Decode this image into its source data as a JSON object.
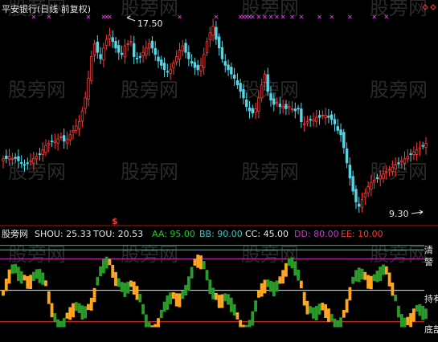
{
  "title": "平安银行(日线 前复权)",
  "panel1": {
    "annotation_high": "17.50",
    "annotation_low": "9.30",
    "dividend_marker": "$"
  },
  "panel2": {
    "name": "股旁网",
    "items": [
      {
        "label": "SHOU: 25.33",
        "color": "#e6e6e6"
      },
      {
        "label": "TOU: 20.53",
        "color": "#e6e6e6"
      },
      {
        "label": "AA: 95.00",
        "color": "#22cc22"
      },
      {
        "label": "BB: 90.00",
        "color": "#33cccc"
      },
      {
        "label": "CC: 45.00",
        "color": "#e6e6e6"
      },
      {
        "label": "DD: 80.00",
        "color": "#cc33cc"
      },
      {
        "label": "EE: 10.00",
        "color": "#ff3333"
      }
    ],
    "right_labels": [
      "清",
      "警",
      "持有",
      "底部"
    ],
    "levels": {
      "AA": 95,
      "BB": 90,
      "DD": 80,
      "CC": 45,
      "EE": 10
    }
  },
  "watermark": "股旁网",
  "colors": {
    "up": "#ff3b3b",
    "down": "#54d8e8",
    "osc_above": "#ffa621",
    "osc_below": "#2a9a2a",
    "separator": "#b01515",
    "marker_x": "#cc33cc",
    "marker_diamond": "#ff3333"
  },
  "chart_data": {
    "type": "candlestick",
    "x": [
      0,
      1,
      2,
      3,
      4,
      5,
      6,
      7,
      8,
      9,
      10,
      11,
      12,
      13,
      14,
      15,
      16,
      17,
      18,
      19,
      20,
      21,
      22,
      23,
      24,
      25,
      26,
      27,
      28,
      29,
      30,
      31,
      32,
      33,
      34,
      35,
      36,
      37,
      38,
      39,
      40,
      41,
      42,
      43,
      44,
      45,
      46,
      47,
      48,
      49,
      50,
      51,
      52,
      53,
      54,
      55,
      56,
      57,
      58,
      59,
      60,
      61,
      62,
      63,
      64,
      65,
      66,
      67,
      68,
      69,
      70,
      71,
      72,
      73,
      74,
      75,
      76,
      77,
      78,
      79,
      80,
      81,
      82,
      83,
      84,
      85,
      86,
      87,
      88,
      89,
      90,
      91,
      92,
      93,
      94,
      95,
      96,
      97,
      98,
      99,
      100,
      101,
      102,
      103,
      104,
      105,
      106,
      107,
      108,
      109,
      110,
      111,
      112,
      113,
      114,
      115,
      116,
      117,
      118,
      119,
      120,
      121,
      122,
      123,
      124,
      125,
      126,
      127,
      128,
      129,
      130,
      131,
      132,
      133,
      134,
      135,
      136,
      137,
      138,
      139
    ],
    "close": [
      11.5,
      11.5,
      11.6,
      11.5,
      11.5,
      11.4,
      11.3,
      11.2,
      11.3,
      11.4,
      11.5,
      11.6,
      11.7,
      11.9,
      12.1,
      12.2,
      12.3,
      12.3,
      12.4,
      12.5,
      12.3,
      12.4,
      12.6,
      12.8,
      13.0,
      13.2,
      13.7,
      14.3,
      15.2,
      16.2,
      16.8,
      16.4,
      16.1,
      16.6,
      17.0,
      17.2,
      16.9,
      16.6,
      16.4,
      16.3,
      16.7,
      16.8,
      16.9,
      16.2,
      16.1,
      16.2,
      16.4,
      16.6,
      16.8,
      16.6,
      16.3,
      16.0,
      15.8,
      15.6,
      15.5,
      15.6,
      15.9,
      16.2,
      16.5,
      16.7,
      16.4,
      16.1,
      15.9,
      15.7,
      15.6,
      15.8,
      16.3,
      16.9,
      17.3,
      17.6,
      17.0,
      16.6,
      16.1,
      15.8,
      15.6,
      15.4,
      15.2,
      14.9,
      14.6,
      14.3,
      13.9,
      13.7,
      13.6,
      13.8,
      14.3,
      14.9,
      15.4,
      14.6,
      14.2,
      14.0,
      14.1,
      13.9,
      13.9,
      13.8,
      13.9,
      13.8,
      13.7,
      13.8,
      13.2,
      13.1,
      13.2,
      13.3,
      13.3,
      13.4,
      13.4,
      13.5,
      13.5,
      13.4,
      13.3,
      13.1,
      12.8,
      12.6,
      12.0,
      11.3,
      10.6,
      10.0,
      9.5,
      9.3,
      9.6,
      9.9,
      10.2,
      10.4,
      10.5,
      10.6,
      10.7,
      10.8,
      10.9,
      11.0,
      11.1,
      11.2,
      11.3,
      11.4,
      11.5,
      11.6,
      11.7,
      11.8,
      11.9,
      12.0,
      12.1,
      12.2
    ]
  }
}
